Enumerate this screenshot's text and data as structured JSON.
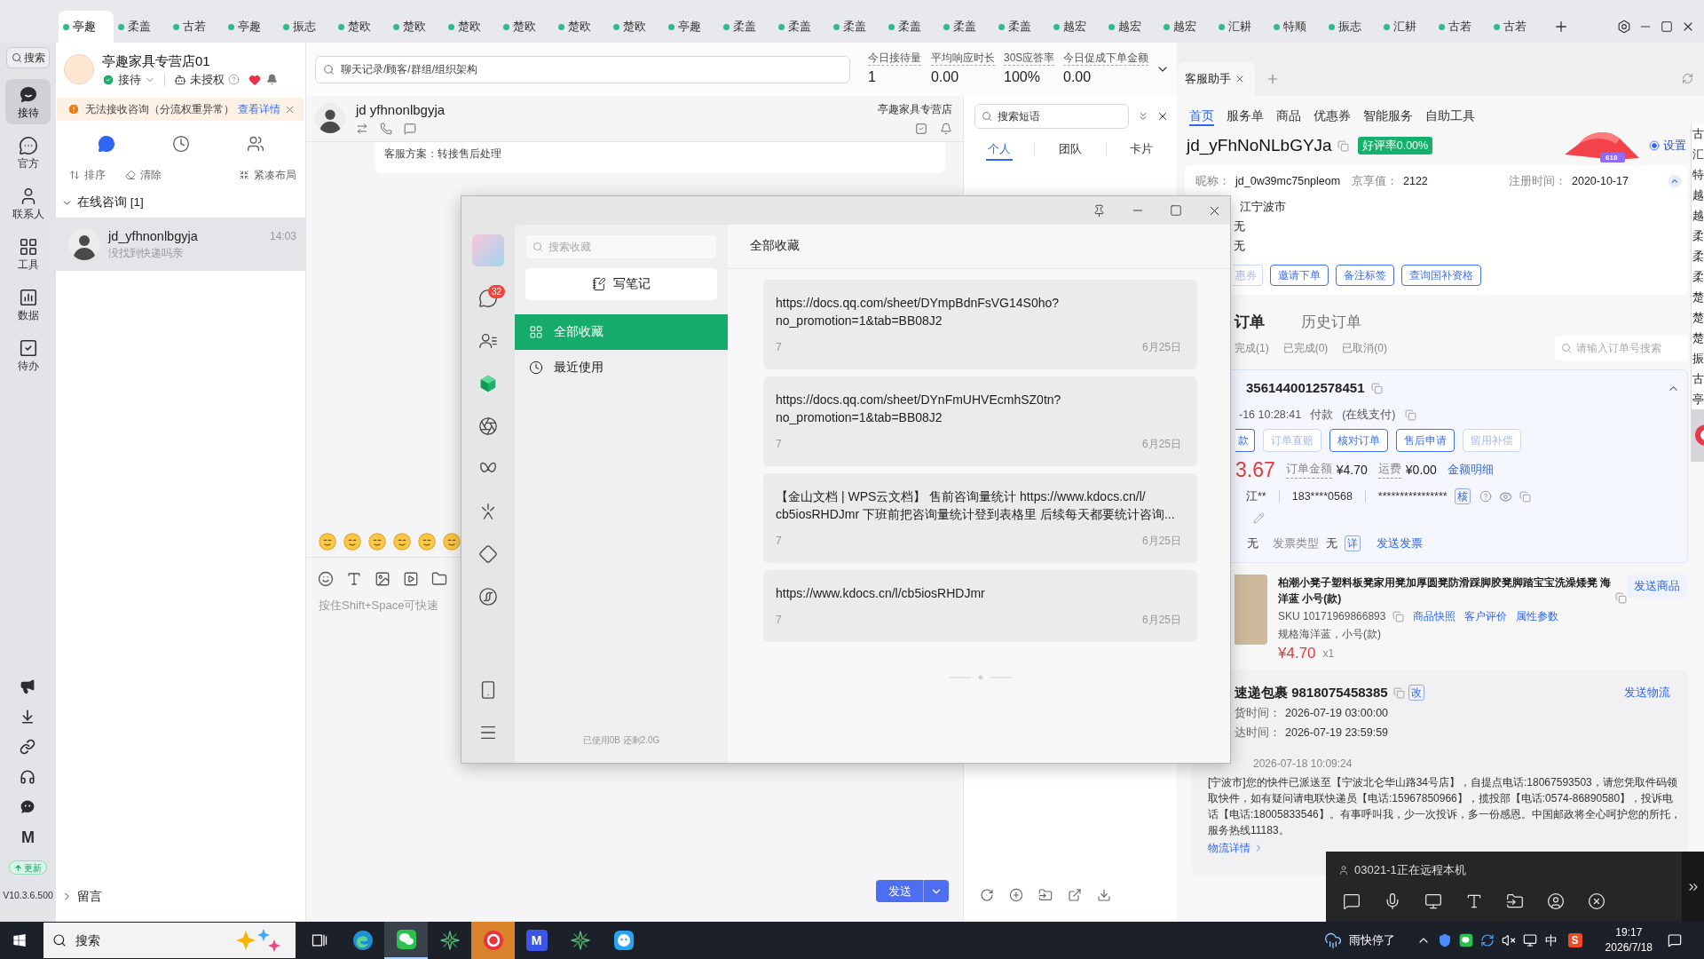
{
  "top_tabs": [
    {
      "label": "亭趣",
      "selected": true
    },
    {
      "label": "柔盖",
      "selected": false
    },
    {
      "label": "古若",
      "selected": false
    },
    {
      "label": "亭趣",
      "selected": false
    },
    {
      "label": "振志",
      "selected": false
    },
    {
      "label": "楚欧",
      "selected": false
    },
    {
      "label": "楚欧",
      "selected": false
    },
    {
      "label": "楚欧",
      "selected": false
    },
    {
      "label": "楚欧",
      "selected": false
    },
    {
      "label": "楚欧",
      "selected": false
    },
    {
      "label": "楚欧",
      "selected": false
    },
    {
      "label": "亭趣",
      "selected": false
    },
    {
      "label": "柔盖",
      "selected": false
    },
    {
      "label": "柔盖",
      "selected": false
    },
    {
      "label": "柔盖",
      "selected": false
    },
    {
      "label": "柔盖",
      "selected": false
    },
    {
      "label": "柔盖",
      "selected": false
    },
    {
      "label": "柔盖",
      "selected": false
    },
    {
      "label": "越宏",
      "selected": false
    },
    {
      "label": "越宏",
      "selected": false
    },
    {
      "label": "越宏",
      "selected": false
    },
    {
      "label": "汇耕",
      "selected": false
    },
    {
      "label": "特顺",
      "selected": false
    },
    {
      "label": "振志",
      "selected": false
    },
    {
      "label": "汇耕",
      "selected": false
    },
    {
      "label": "古若",
      "selected": false
    },
    {
      "label": "古若",
      "selected": false
    }
  ],
  "nav": {
    "search": "搜索",
    "items": [
      {
        "label": "接待",
        "selected": true
      },
      {
        "label": "官方",
        "selected": false
      },
      {
        "label": "联系人",
        "selected": false
      },
      {
        "label": "工具",
        "selected": false
      },
      {
        "label": "数据",
        "selected": false
      },
      {
        "label": "待办",
        "selected": false
      }
    ],
    "logo": "M",
    "update": "更新",
    "version": "V10.3.6.500"
  },
  "store": {
    "name": "亭趣家具专营店01",
    "status": "接待",
    "auth": "未授权"
  },
  "warning": {
    "text": "无法接收咨询（分流权重异常）",
    "link": "查看详情"
  },
  "list_tabs": [
    {
      "selected": true
    },
    {
      "selected": false
    },
    {
      "selected": false
    }
  ],
  "list_actions": [
    "排序",
    "清除",
    "紧凑布局"
  ],
  "online_group": {
    "label": "在线咨询 [1]",
    "expanded": true
  },
  "conversations": [
    {
      "name": "jd_yfhnonlbgyja",
      "time": "14:03",
      "preview": "没找到快递吗亲",
      "selected": true
    }
  ],
  "message_group": {
    "label": "留言",
    "expanded": false
  },
  "chat": {
    "search_placeholder": "聊天记录/顾客/群组/组织架构",
    "stats": [
      {
        "label": "今日接待量",
        "value": "1"
      },
      {
        "label": "平均响应时长",
        "value": "0.00"
      },
      {
        "label": "30S应答率",
        "value": "100%"
      },
      {
        "label": "今日促成下单金额",
        "value": "0.00"
      }
    ],
    "contact": "jd yfhnonlbgyja",
    "shop": "亭趣家具专营店",
    "messages": [
      {
        "text": "客服方案：转接售后处理"
      }
    ],
    "input_placeholder": "按住Shift+Space可快速",
    "send": "发送"
  },
  "phrases": {
    "search_placeholder": "搜索短语",
    "tabs": [
      {
        "label": "个人",
        "selected": true
      },
      {
        "label": "团队",
        "selected": false
      },
      {
        "label": "卡片",
        "selected": false
      }
    ]
  },
  "assistant": {
    "tab": "客服助手",
    "nav": [
      {
        "label": "首页",
        "selected": true
      },
      {
        "label": "服务单",
        "selected": false
      },
      {
        "label": "商品",
        "selected": false
      },
      {
        "label": "优惠券",
        "selected": false
      },
      {
        "label": "智能服务",
        "selected": false
      },
      {
        "label": "自助工具",
        "selected": false
      }
    ],
    "customer": {
      "id": "jd_yFhNoNLbGYJa",
      "rating": "好评率0.00%",
      "promo": "618",
      "settings": "设置",
      "fields": [
        {
          "label": "昵称：",
          "value": "jd_0w39mc75npleom"
        },
        {
          "label": "京享值：",
          "value": "2122"
        },
        {
          "label": "注册时间：",
          "value": "2020-10-17"
        }
      ],
      "lines": [
        "江宁波市",
        "无",
        "无"
      ]
    },
    "actions": [
      {
        "label": "惠券",
        "disabled": true
      },
      {
        "label": "邀请下单",
        "disabled": false
      },
      {
        "label": "备注标签",
        "disabled": false
      },
      {
        "label": "查询国补资格",
        "disabled": false
      }
    ]
  },
  "orders": {
    "tabs": [
      {
        "label": "订单",
        "selected": true
      },
      {
        "label": "历史订单",
        "selected": false
      }
    ],
    "filters": [
      "完成(1)",
      "已完成(0)",
      "已取消(0)"
    ],
    "search_placeholder": "请输入订单号搜索"
  },
  "order": {
    "number": "3561440012578451",
    "time_parts": [
      "-16 10:28:41",
      "付款",
      "(在线支付)"
    ],
    "actions": [
      {
        "label": "款",
        "disabled": false
      },
      {
        "label": "订单直赔",
        "disabled": true
      },
      {
        "label": "核对订单",
        "disabled": false
      },
      {
        "label": "售后申请",
        "disabled": false
      },
      {
        "label": "留用补偿",
        "disabled": true
      }
    ],
    "paid": "3.67",
    "amount_label": "订单金额",
    "amount": "¥4.70",
    "freight_label": "运费",
    "freight": "¥0.00",
    "detail_link": "金额明细",
    "receiver": "江**",
    "phone": "183****0568",
    "address": "****************",
    "verify": "核",
    "invoice": {
      "value": "无",
      "type_label": "发票类型",
      "type": "无",
      "detail": "详",
      "send": "发送发票"
    }
  },
  "product": {
    "title": "柏潮小凳子塑料板凳家用凳加厚圆凳防滑踩脚胶凳脚踏宝宝洗澡矮凳 海洋蓝 小号(款)",
    "send": "发送商品",
    "sku": "SKU 10171969866893",
    "links": [
      "商品快照",
      "客户评价",
      "属性参数"
    ],
    "spec": "规格海洋蓝，小号(款)",
    "price": "¥4.70",
    "qty": "x1"
  },
  "logistics": {
    "title": "速递包裹 9818075458385",
    "edit": "改",
    "send": "发送物流",
    "rows": [
      {
        "label": "货时间：",
        "value": "2026-07-19 03:00:00"
      },
      {
        "label": "达时间：",
        "value": "2026-07-19 23:59:59"
      }
    ],
    "time": "2026-07-18 10:09:24",
    "text": "[宁波市]您的快件已派送至【宁波北仑华山路34号店】，自提点电话:18067593503，请您凭取件码领取快件，如有疑问请电联快递员【电话:15967850966】，揽投部【电话:0574-86890580】，投诉电话【电话:18005833546】。有事呼叫我，少一次投诉，多一份感恩。中国邮政将全心呵护您的所托，服务热线11183。",
    "link": "物流详情"
  },
  "tab_overflow": [
    "古",
    "汇",
    "特",
    "越",
    "越",
    "柔",
    "柔",
    "柔",
    "楚",
    "楚",
    "楚",
    "振",
    "古",
    "亭"
  ],
  "favorites": {
    "search_placeholder": "搜索收藏",
    "badge": "32",
    "note_button": "写笔记",
    "categories": [
      {
        "label": "全部收藏",
        "selected": true
      },
      {
        "label": "最近使用",
        "selected": false
      }
    ],
    "storage": "已使用0B 还剩2.0G",
    "title": "全部收藏",
    "items": [
      {
        "lines": [
          "https://docs.qq.com/sheet/DYmpBdnFsVG14S0ho?",
          "no_promotion=1&tab=BB08J2"
        ],
        "count": "7",
        "date": "6月25日"
      },
      {
        "lines": [
          "https://docs.qq.com/sheet/DYnFmUHVEcmhSZ0tn?",
          "no_promotion=1&tab=BB08J2"
        ],
        "count": "7",
        "date": "6月25日"
      },
      {
        "lines": [
          "【金山文档 | WPS云文档】 售前咨询量统计 https://www.kdocs.cn/l/",
          "cb5iosRHDJmr 下班前把咨询量统计登到表格里 后续每天都要统计咨询..."
        ],
        "count": "7",
        "date": "6月25日"
      },
      {
        "lines": [
          "https://www.kdocs.cn/l/cb5iosRHDJmr"
        ],
        "count": "7",
        "date": "6月25日"
      }
    ]
  },
  "remote": {
    "text": "03021-1正在远程本机"
  },
  "taskbar": {
    "search_placeholder": "搜索",
    "apps": [
      {
        "kind": "taskview",
        "active": false,
        "flashing": false
      },
      {
        "kind": "swirl",
        "active": false,
        "flashing": false
      },
      {
        "kind": "chat",
        "active": true,
        "flashing": false
      },
      {
        "kind": "star",
        "active": false,
        "flashing": false
      },
      {
        "kind": "ring",
        "active": false,
        "flashing": true
      },
      {
        "kind": "tile",
        "label": "M",
        "active": false,
        "flashing": false
      },
      {
        "kind": "star",
        "active": false,
        "flashing": false
      },
      {
        "kind": "bubble",
        "active": false,
        "flashing": false
      }
    ],
    "weather": "雨快停了",
    "ime": "中",
    "ime_logo": "S",
    "time": "19:17",
    "date": "2026/7/18"
  }
}
